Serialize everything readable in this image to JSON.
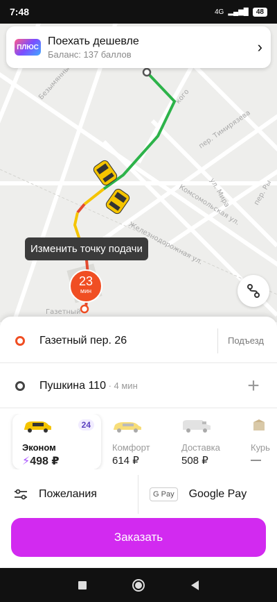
{
  "status": {
    "time": "7:48",
    "network": "4G",
    "battery": "48"
  },
  "promo": {
    "badge": "ПЛЮС",
    "title": "Поехать дешевле",
    "subtitle": "Баланс: 137 баллов"
  },
  "map": {
    "streets": [
      "Безымянный пер.",
      "пер. Тимирязева",
      "ул. Мира",
      "пер. Ры",
      "Комсомольская ул.",
      "Железнодорожная ул.",
      "Газетный",
      "кого"
    ],
    "tooltip": "Изменить точку подачи",
    "eta_value": "23",
    "eta_unit": "мин"
  },
  "route": {
    "from": "Газетный пер. 26",
    "entrance": "Подъезд",
    "to": "Пушкина 110",
    "to_eta": " · 4 мин"
  },
  "tariffs": [
    {
      "name": "Эконом",
      "price": "498 ₽",
      "badge": "24",
      "selected": true
    },
    {
      "name": "Комфорт",
      "price": "614 ₽"
    },
    {
      "name": "Доставка",
      "price": "508 ₽"
    },
    {
      "name": "Курь",
      "price": "—"
    }
  ],
  "options": {
    "wishes": "Пожелания",
    "gpay_icon": "G Pay",
    "payment": "Google Pay"
  },
  "order_button": "Заказать",
  "colors": {
    "accent": "#d22af0",
    "origin": "#f04e23",
    "route_green": "#2db34a",
    "route_yellow": "#f5c400"
  }
}
